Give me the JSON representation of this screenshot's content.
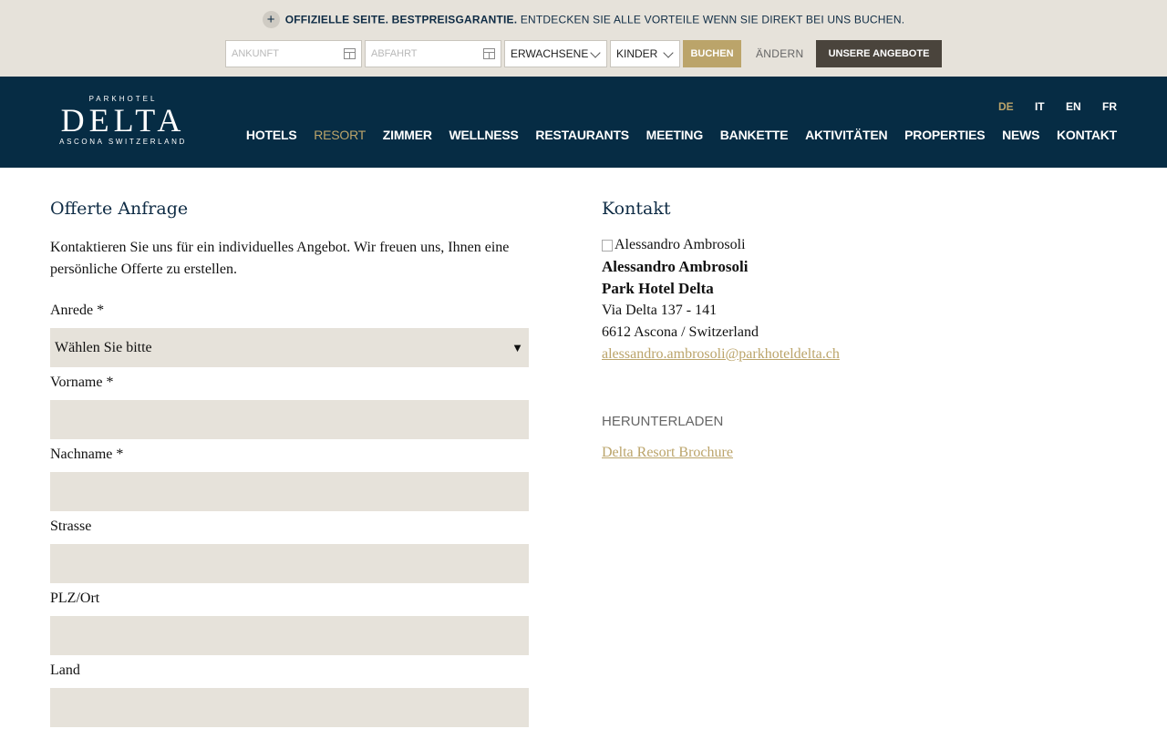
{
  "promo": {
    "strong": "OFFIZIELLE SEITE. BESTPREISGARANTIE.",
    "text": "ENTDECKEN SIE ALLE VORTEILE WENN SIE DIREKT BEI UNS BUCHEN."
  },
  "booking": {
    "arrival_placeholder": "ANKUNFT",
    "departure_placeholder": "ABFAHRT",
    "adults_label": "ERWACHSENE",
    "children_label": "KINDER",
    "book_button": "BUCHEN",
    "change_link": "ÄNDERN",
    "offers_button": "UNSERE ANGEBOTE"
  },
  "logo": {
    "top": "PARKHOTEL",
    "main": "DELTA",
    "sub": "ASCONA SWITZERLAND"
  },
  "languages": [
    "DE",
    "IT",
    "EN",
    "FR"
  ],
  "nav": [
    "HOTELS",
    "RESORT",
    "ZIMMER",
    "WELLNESS",
    "RESTAURANTS",
    "MEETING",
    "BANKETTE",
    "AKTIVITÄTEN",
    "PROPERTIES",
    "NEWS",
    "KONTAKT"
  ],
  "colors": {
    "header": "#062c44",
    "gold": "#bba46a",
    "beige": "#e6e2da",
    "dark_button": "#4a443c"
  },
  "form": {
    "title": "Offerte Anfrage",
    "intro": "Kontaktieren Sie uns für ein individuelles Angebot. Wir freuen uns, Ihnen eine persönliche Offerte zu erstellen.",
    "salutation_label": "Anrede *",
    "salutation_value": "Wählen Sie bitte",
    "firstname_label": "Vorname *",
    "lastname_label": "Nachname *",
    "street_label": "Strasse",
    "zip_label": "PLZ/Ort",
    "country_label": "Land"
  },
  "contact": {
    "title": "Kontakt",
    "image_alt": "Alessandro Ambrosoli",
    "name": "Alessandro Ambrosoli",
    "company": "Park Hotel Delta",
    "street": "Via Delta 137 - 141",
    "city": "6612 Ascona / Switzerland",
    "email": "alessandro.ambrosoli@parkhoteldelta.ch",
    "download_heading": "HERUNTERLADEN",
    "download_link": "Delta Resort Brochure"
  }
}
